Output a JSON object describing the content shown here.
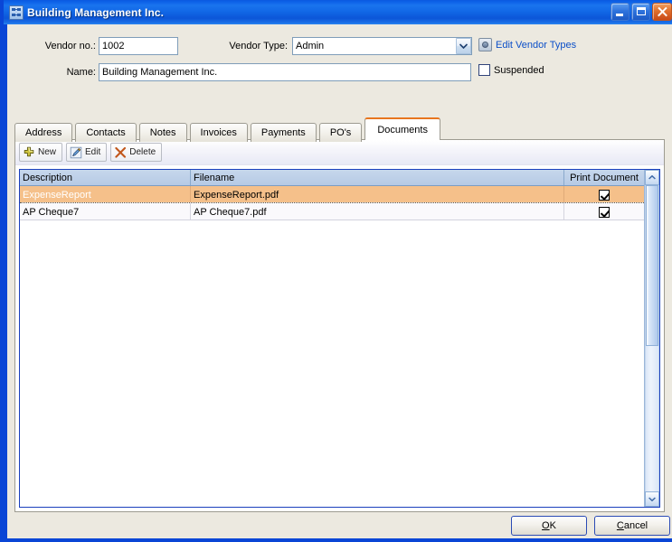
{
  "window": {
    "title": "Building Management Inc.",
    "icon": "form-window-icon",
    "controls": {
      "minimize": "Minimize",
      "maximize": "Maximize",
      "close": "Close"
    },
    "accent_blue": "#0a46d6",
    "accent_orange": "#e8761f",
    "selection_peach": "#f5c08a"
  },
  "form": {
    "vendor_no_label": "Vendor no.:",
    "vendor_no_value": "1002",
    "name_label": "Name:",
    "name_value": "Building Management Inc.",
    "vendor_type_label": "Vendor Type:",
    "vendor_type_value": "Admin",
    "vendor_type_options": [
      "Admin"
    ],
    "edit_vendor_types_link": "Edit Vendor Types",
    "suspended_label": "Suspended",
    "suspended_checked": false
  },
  "tabs": [
    {
      "label": "Address",
      "active": false
    },
    {
      "label": "Contacts",
      "active": false
    },
    {
      "label": "Notes",
      "active": false
    },
    {
      "label": "Invoices",
      "active": false
    },
    {
      "label": "Payments",
      "active": false
    },
    {
      "label": "PO's",
      "active": false
    },
    {
      "label": "Documents",
      "active": true
    }
  ],
  "toolbar": {
    "new_label": "New",
    "edit_label": "Edit",
    "delete_label": "Delete"
  },
  "grid": {
    "columns": [
      "Description",
      "Filename",
      "Print Document"
    ],
    "rows": [
      {
        "description": "ExpenseReport",
        "filename": "ExpenseReport.pdf",
        "print_document": true,
        "selected": true
      },
      {
        "description": "AP Cheque7",
        "filename": "AP Cheque7.pdf",
        "print_document": false,
        "selected": false
      }
    ]
  },
  "scrollbar": {
    "up_arrow": "chevron-up-icon",
    "down_arrow": "chevron-down-icon"
  },
  "footer": {
    "ok_label": "OK",
    "ok_accel": "O",
    "cancel_label": "Cancel",
    "cancel_accel": "C"
  }
}
